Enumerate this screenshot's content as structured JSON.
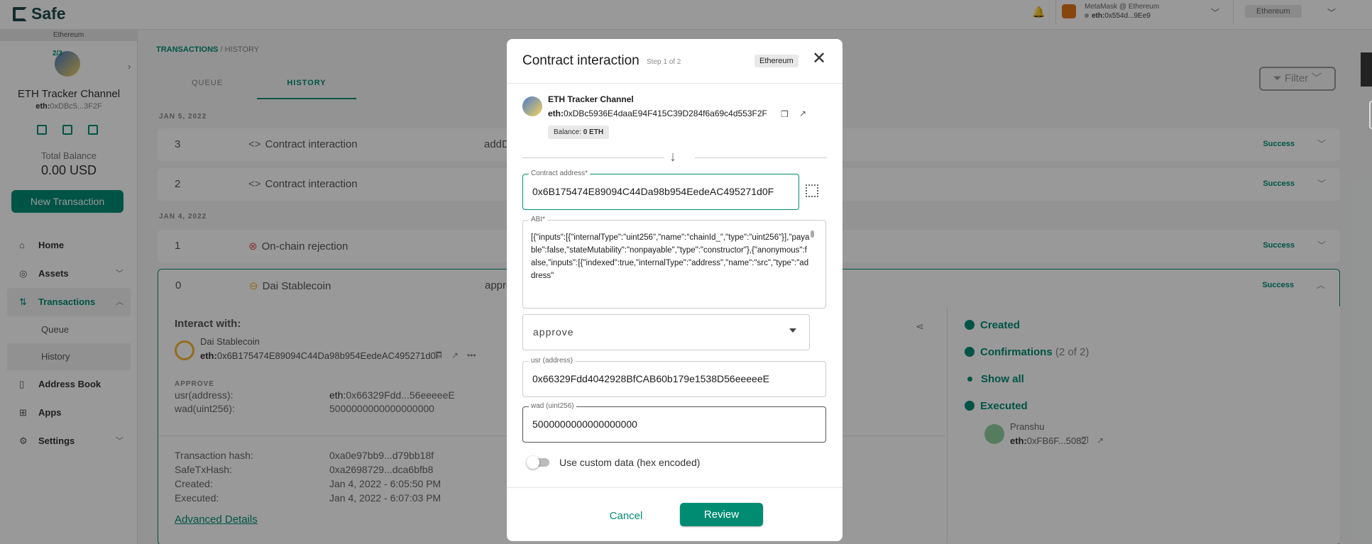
{
  "app": {
    "logo": "Safe"
  },
  "header": {
    "wallet_line1": "MetaMask @ Ethereum",
    "wallet_prefix": "eth:",
    "wallet_addr": "0x554d...9Ee9",
    "network": "Ethereum"
  },
  "sidebar": {
    "chain": "Ethereum",
    "threshold": "2/3",
    "safe_name": "ETH Tracker Channel",
    "safe_prefix": "eth:",
    "safe_addr": "0xDBc5...3F2F",
    "balance_label": "Total Balance",
    "balance_value": "0.00 USD",
    "new_tx_label": "New Transaction",
    "nav": [
      {
        "label": "Home",
        "icon": "home-icon"
      },
      {
        "label": "Assets",
        "icon": "assets-icon"
      },
      {
        "label": "Transactions",
        "icon": "transactions-icon"
      },
      {
        "label": "Address Book",
        "icon": "address-book-icon"
      },
      {
        "label": "Apps",
        "icon": "apps-icon"
      },
      {
        "label": "Settings",
        "icon": "settings-icon"
      }
    ],
    "sub": [
      {
        "label": "Queue"
      },
      {
        "label": "History"
      }
    ]
  },
  "main": {
    "breadcrumb_root": "TRANSACTIONS",
    "breadcrumb_sep": "/",
    "breadcrumb_leaf": "HISTORY",
    "tabs": [
      {
        "label": "QUEUE"
      },
      {
        "label": "HISTORY"
      }
    ],
    "filter_label": "Filter",
    "groups": [
      {
        "date": "JAN 5, 2022"
      },
      {
        "date": "JAN 4, 2022"
      }
    ],
    "rows": [
      {
        "nonce": "3",
        "type": "Contract interaction",
        "info": "addD",
        "status": "Success"
      },
      {
        "nonce": "2",
        "type": "Contract interaction",
        "info": "",
        "status": "Success"
      },
      {
        "nonce": "1",
        "type": "On-chain rejection",
        "info": "",
        "status": "Success"
      },
      {
        "nonce": "0",
        "type": "Dai Stablecoin",
        "info": "appro",
        "status": "Success"
      }
    ],
    "detail": {
      "interact_label": "Interact with:",
      "contract_name": "Dai Stablecoin",
      "contract_prefix": "eth:",
      "contract_addr": "0x6B175474E89094C44Da98b954EedeAC495271d0F",
      "method": "APPROVE",
      "params": [
        {
          "key": "usr(address):",
          "prefix": "eth:",
          "value": "0x66329Fdd...56eeeeeE"
        },
        {
          "key": "wad(uint256):",
          "prefix": "",
          "value": "5000000000000000000"
        }
      ],
      "hashes": [
        {
          "key": "Transaction hash:",
          "value": "0xa0e97bb9...d79bb18f"
        },
        {
          "key": "SafeTxHash:",
          "value": "0xa2698729...dca6bfb8"
        },
        {
          "key": "Created:",
          "value": "Jan 4, 2022 - 6:05:50 PM"
        },
        {
          "key": "Executed:",
          "value": "Jan 4, 2022 - 6:07:03 PM"
        }
      ],
      "advanced": "Advanced Details",
      "steps": {
        "created": "Created",
        "confirmations": "Confirmations",
        "confirmations_count": "(2 of 2)",
        "show_all": "Show all",
        "executed": "Executed",
        "signer_name": "Pranshu",
        "signer_prefix": "eth:",
        "signer_addr": "0xFB6F...5082"
      }
    }
  },
  "modal": {
    "title": "Contract interaction",
    "step": "Step 1 of 2",
    "network": "Ethereum",
    "safe_name": "ETH Tracker Channel",
    "safe_prefix": "eth:",
    "safe_addr": "0xDBc5936E4daaE94F415C39D284f6a69c4d553F2F",
    "balance_label": "Balance:",
    "balance_value": "0 ETH",
    "contract_label": "Contract address*",
    "contract_value": "0x6B175474E89094C44Da98b954EedeAC495271d0F",
    "abi_label": "ABI*",
    "abi_value": "[{\"inputs\":[{\"internalType\":\"uint256\",\"name\":\"chainId_\",\"type\":\"uint256\"}],\"payable\":false,\"stateMutability\":\"nonpayable\",\"type\":\"constructor\"},{\"anonymous\":false,\"inputs\":[{\"indexed\":true,\"internalType\":\"address\",\"name\":\"src\",\"type\":\"address\"",
    "method_value": "approve",
    "usr_label": "usr (address)",
    "usr_value": "0x66329Fdd4042928BfCAB60b179e1538D56eeeeeE",
    "wad_label": "wad (uint256)",
    "wad_value": "5000000000000000000",
    "custom_data_label": "Use custom data (hex encoded)",
    "cancel": "Cancel",
    "review": "Review"
  }
}
